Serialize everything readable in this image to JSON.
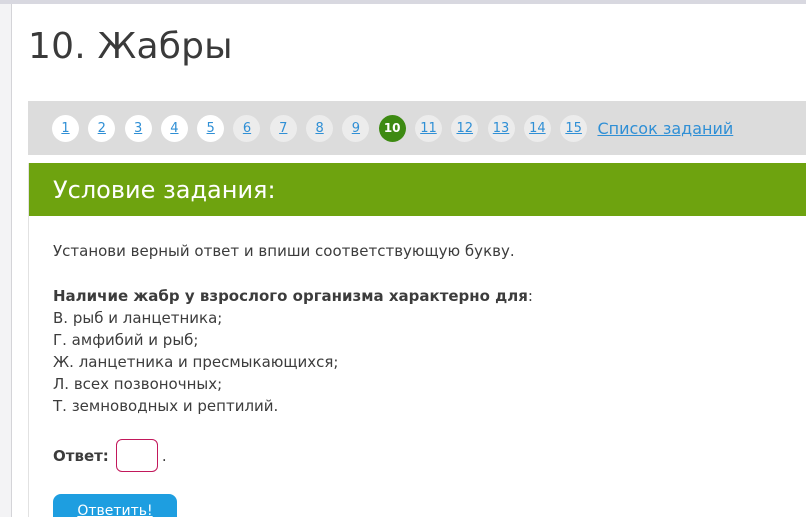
{
  "page": {
    "title": "10. Жабры"
  },
  "pager": {
    "pages": [
      {
        "label": "1",
        "state": "visited"
      },
      {
        "label": "2",
        "state": "visited"
      },
      {
        "label": "3",
        "state": "visited"
      },
      {
        "label": "4",
        "state": "visited"
      },
      {
        "label": "5",
        "state": "visited"
      },
      {
        "label": "6",
        "state": "unvisited"
      },
      {
        "label": "7",
        "state": "unvisited"
      },
      {
        "label": "8",
        "state": "unvisited"
      },
      {
        "label": "9",
        "state": "unvisited"
      },
      {
        "label": "10",
        "state": "current"
      },
      {
        "label": "11",
        "state": "unvisited"
      },
      {
        "label": "12",
        "state": "unvisited"
      },
      {
        "label": "13",
        "state": "unvisited"
      },
      {
        "label": "14",
        "state": "unvisited"
      },
      {
        "label": "15",
        "state": "unvisited"
      }
    ],
    "task_list_label": "Список заданий"
  },
  "task": {
    "header": "Условие задания:",
    "instruction": "Установи верный ответ и впиши соответствующую букву.",
    "question": "Наличие жабр у взрослого организма характерно для",
    "question_suffix": ":",
    "options": [
      "В. рыб и ланцетника;",
      "Г. амфибий и рыб;",
      "Ж. ланцетника и пресмыкающихся;",
      "Л. всех позвоночных;",
      "Т. земноводных и рептилий."
    ],
    "answer_label": "Ответ:",
    "answer_value": "",
    "answer_suffix": ".",
    "submit_label": "Ответить!"
  },
  "colors": {
    "header_green": "#6ea30f",
    "current_page_green": "#3d8a12",
    "link_blue": "#2f8fd5",
    "submit_blue": "#1e9ee0",
    "input_border": "#c2185b"
  }
}
